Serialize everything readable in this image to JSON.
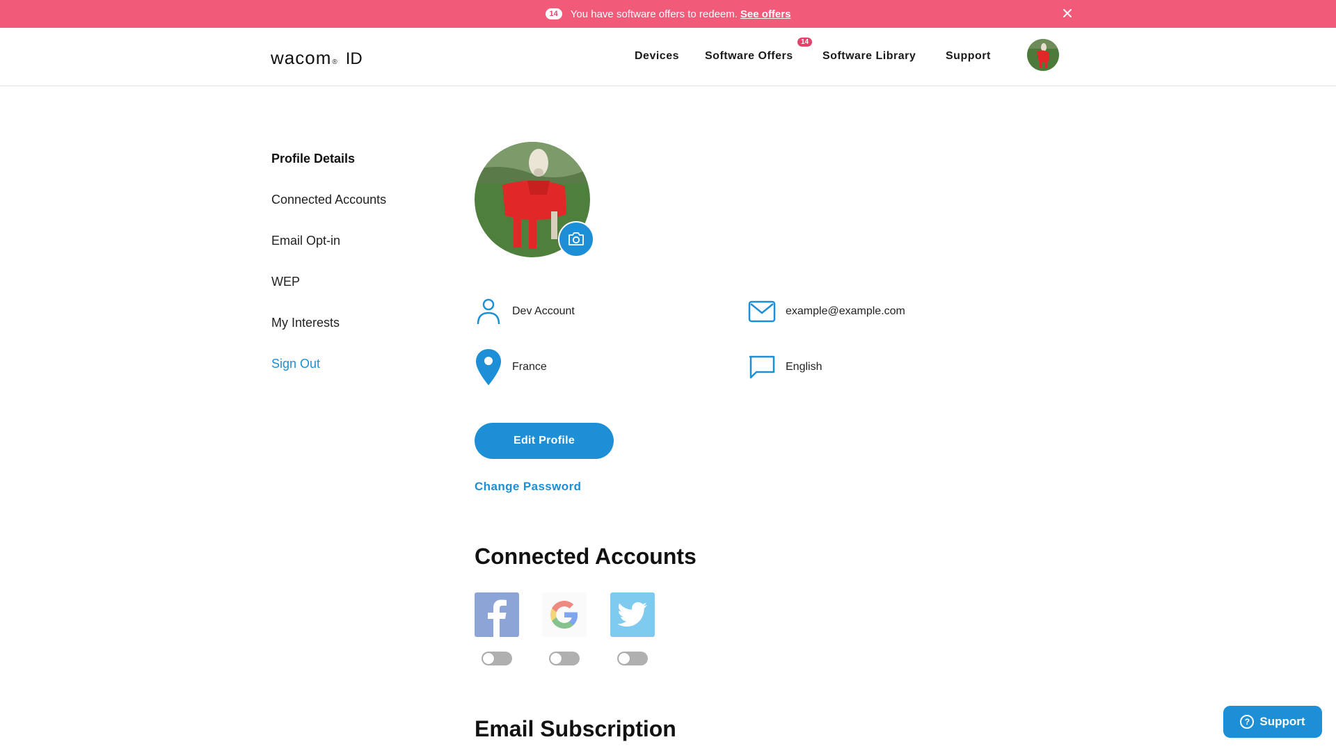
{
  "banner": {
    "count": "14",
    "message": "You have software offers to redeem.",
    "link": "See offers",
    "close_icon": "close-icon"
  },
  "header": {
    "brand": "wacom",
    "brand_suffix": "ID",
    "nav": [
      {
        "label": "Devices"
      },
      {
        "label": "Software Offers",
        "badge": "14"
      },
      {
        "label": "Software Library"
      },
      {
        "label": "Support"
      }
    ]
  },
  "sidebar": {
    "items": [
      {
        "label": "Profile Details"
      },
      {
        "label": "Connected Accounts"
      },
      {
        "label": "Email Opt-in"
      },
      {
        "label": "WEP"
      },
      {
        "label": "My Interests"
      },
      {
        "label": "Sign Out"
      }
    ]
  },
  "profile": {
    "name": "Dev Account",
    "email": "example@example.com",
    "country": "France",
    "language": "English",
    "edit_label": "Edit Profile",
    "change_password_label": "Change Password"
  },
  "connected_accounts": {
    "title": "Connected Accounts",
    "providers": [
      {
        "icon": "facebook-icon",
        "enabled": false
      },
      {
        "icon": "google-icon",
        "enabled": false
      },
      {
        "icon": "twitter-icon",
        "enabled": false
      }
    ]
  },
  "email_subscription": {
    "title": "Email Subscription"
  },
  "support_widget": {
    "label": "Support"
  },
  "colors": {
    "banner": "#f25a7a",
    "accent": "#1d8fd6",
    "badge": "#e0446a"
  }
}
